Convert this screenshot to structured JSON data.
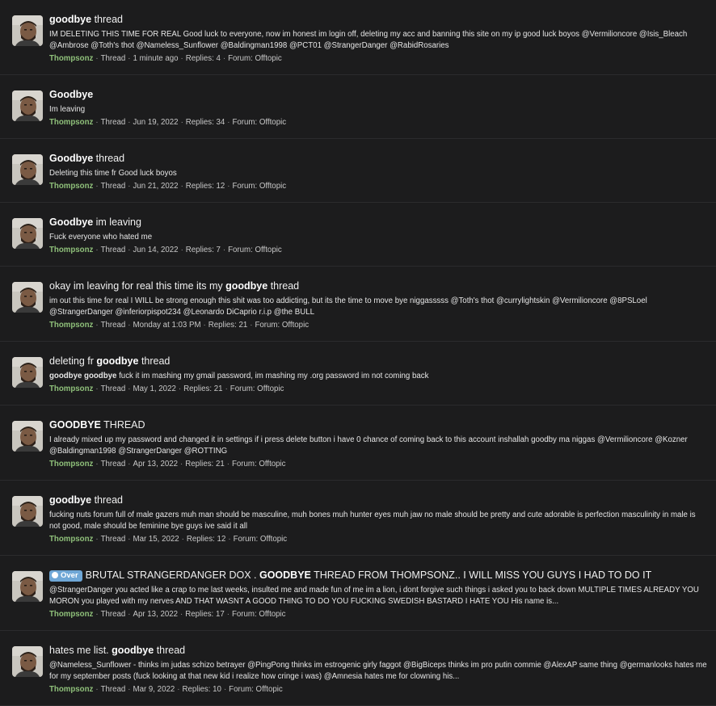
{
  "results": [
    {
      "title_parts": [
        {
          "text": "goodbye",
          "bold": true
        },
        {
          "text": " thread",
          "bold": false
        }
      ],
      "snippet_parts": [
        {
          "text": "IM DELETING THIS TIME FOR REAL Good luck to everyone, now im honest im login off, deleting my acc and banning this site on my ip good luck boyos @Vermilioncore @Isis_Bleach @Ambrose @Toth's thot @Nameless_Sunflower @Baldingman1998 @PCT01 @StrangerDanger @RabidRosaries",
          "bold": false
        }
      ],
      "author": "Thompsonz",
      "type": "Thread",
      "date": "1 minute ago",
      "replies": "Replies: 4",
      "forum": "Forum: Offtopic"
    },
    {
      "title_parts": [
        {
          "text": "Goodbye",
          "bold": true
        }
      ],
      "snippet_parts": [
        {
          "text": "Im leaving",
          "bold": false
        }
      ],
      "author": "Thompsonz",
      "type": "Thread",
      "date": "Jun 19, 2022",
      "replies": "Replies: 34",
      "forum": "Forum: Offtopic"
    },
    {
      "title_parts": [
        {
          "text": "Goodbye",
          "bold": true
        },
        {
          "text": " thread",
          "bold": false
        }
      ],
      "snippet_parts": [
        {
          "text": "Deleting this time fr Good luck boyos",
          "bold": false
        }
      ],
      "author": "Thompsonz",
      "type": "Thread",
      "date": "Jun 21, 2022",
      "replies": "Replies: 12",
      "forum": "Forum: Offtopic"
    },
    {
      "title_parts": [
        {
          "text": "Goodbye",
          "bold": true
        },
        {
          "text": " im leaving",
          "bold": false
        }
      ],
      "snippet_parts": [
        {
          "text": "Fuck everyone who hated me",
          "bold": false
        }
      ],
      "author": "Thompsonz",
      "type": "Thread",
      "date": "Jun 14, 2022",
      "replies": "Replies: 7",
      "forum": "Forum: Offtopic"
    },
    {
      "title_parts": [
        {
          "text": "okay im leaving for real this time its my ",
          "bold": false
        },
        {
          "text": "goodbye",
          "bold": true
        },
        {
          "text": " thread",
          "bold": false
        }
      ],
      "snippet_parts": [
        {
          "text": "im out this time for real I WILL be strong enough this shit was too addicting, but its the time to move bye niggasssss @Toth's thot @currylightskin @Vermilioncore @8PSLoel @StrangerDanger @inferiorpispot234 @Leonardo DiCaprio r.i.p @the BULL",
          "bold": false
        }
      ],
      "author": "Thompsonz",
      "type": "Thread",
      "date": "Monday at 1:03 PM",
      "replies": "Replies: 21",
      "forum": "Forum: Offtopic"
    },
    {
      "title_parts": [
        {
          "text": "deleting fr ",
          "bold": false
        },
        {
          "text": "goodbye",
          "bold": true
        },
        {
          "text": " thread",
          "bold": false
        }
      ],
      "snippet_parts": [
        {
          "text": "goodbye goodbye",
          "bold": true
        },
        {
          "text": " fuck it im mashing my gmail password, im mashing my .org password im not coming back",
          "bold": false
        }
      ],
      "author": "Thompsonz",
      "type": "Thread",
      "date": "May 1, 2022",
      "replies": "Replies: 21",
      "forum": "Forum: Offtopic"
    },
    {
      "title_parts": [
        {
          "text": "GOODBYE",
          "bold": true
        },
        {
          "text": " THREAD",
          "bold": false
        }
      ],
      "snippet_parts": [
        {
          "text": "I already mixed up my password and changed it in settings if i press delete button i have 0 chance of coming back to this account inshallah goodby ma niggas @Vermilioncore @Kozner @Baldingman1998 @StrangerDanger @ROTTING",
          "bold": false
        }
      ],
      "author": "Thompsonz",
      "type": "Thread",
      "date": "Apr 13, 2022",
      "replies": "Replies: 21",
      "forum": "Forum: Offtopic"
    },
    {
      "title_parts": [
        {
          "text": "goodbye",
          "bold": true
        },
        {
          "text": " thread",
          "bold": false
        }
      ],
      "snippet_parts": [
        {
          "text": "fucking nuts forum full of male gazers muh man should be masculine, muh bones muh hunter eyes muh jaw no male should be pretty and cute adorable is perfection masculinity in male is not good, male should be feminine bye guys ive said it all",
          "bold": false
        }
      ],
      "author": "Thompsonz",
      "type": "Thread",
      "date": "Mar 15, 2022",
      "replies": "Replies: 12",
      "forum": "Forum: Offtopic"
    },
    {
      "badge": "Over",
      "title_parts": [
        {
          "text": "BRUTAL STRANGERDANGER DOX . ",
          "bold": false
        },
        {
          "text": "GOODBYE",
          "bold": true
        },
        {
          "text": " THREAD FROM THOMPSONZ.. I WILL MISS YOU GUYS I HAD TO DO IT",
          "bold": false
        }
      ],
      "snippet_parts": [
        {
          "text": "@StrangerDanger you acted like a crap to me last weeks, insulted me and made fun of me im a lion, i dont forgive such things i asked you to back down MULTIPLE TIMES ALREADY YOU MORON you played with my nerves AND THAT WASNT A GOOD THING TO DO YOU FUCKING SWEDISH BASTARD I HATE YOU His name is...",
          "bold": false
        }
      ],
      "author": "Thompsonz",
      "type": "Thread",
      "date": "Apr 13, 2022",
      "replies": "Replies: 17",
      "forum": "Forum: Offtopic"
    },
    {
      "title_parts": [
        {
          "text": "hates me list. ",
          "bold": false
        },
        {
          "text": "goodbye",
          "bold": true
        },
        {
          "text": " thread",
          "bold": false
        }
      ],
      "snippet_parts": [
        {
          "text": "@Nameless_Sunflower - thinks im judas schizo betrayer @PingPong thinks im estrogenic girly faggot @BigBiceps thinks im pro putin commie @AlexAP same thing @germanlooks hates me for my september posts (fuck looking at that new kid i realize how cringe i was) @Amnesia hates me for clowning his...",
          "bold": false
        }
      ],
      "author": "Thompsonz",
      "type": "Thread",
      "date": "Mar 9, 2022",
      "replies": "Replies: 10",
      "forum": "Forum: Offtopic"
    }
  ],
  "colors": {
    "author": "#8fc07a",
    "badge": "#6fa7d6",
    "background": "#1c1c1d"
  }
}
